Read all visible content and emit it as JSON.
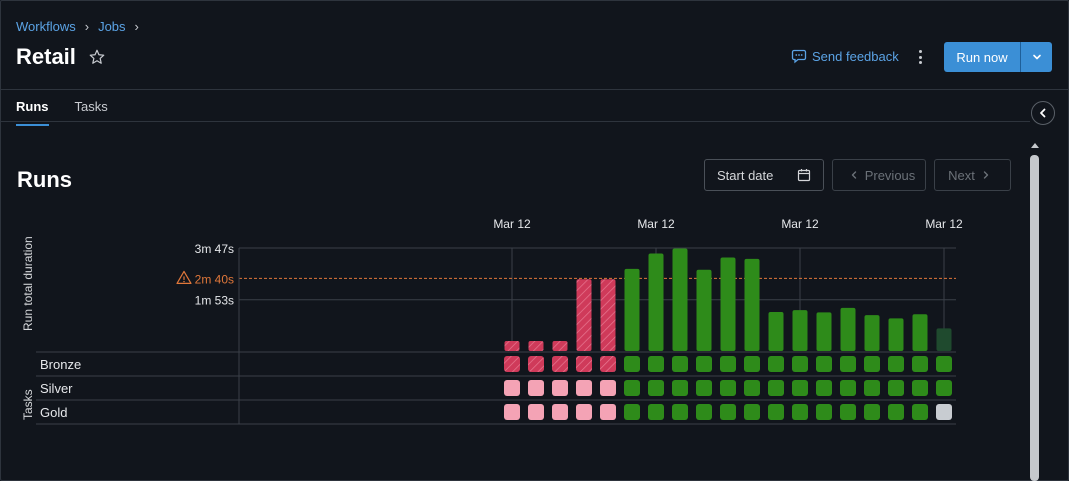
{
  "breadcrumb": {
    "items": [
      "Workflows",
      "Jobs"
    ],
    "separator": "›"
  },
  "header": {
    "title": "Retail",
    "feedback_label": "Send feedback",
    "run_now_label": "Run now"
  },
  "tabs": [
    {
      "label": "Runs",
      "active": true
    },
    {
      "label": "Tasks",
      "active": false
    }
  ],
  "runs": {
    "title": "Runs",
    "start_date_placeholder": "Start date",
    "previous_label": "Previous",
    "next_label": "Next"
  },
  "colors": {
    "accent": "#3b8fd6",
    "link": "#5ba3e5",
    "success": "#2e8b1a",
    "failed": "#d13b5c",
    "failed_light": "#f4a3b5",
    "pending": "#c8ccd1",
    "warning": "#e0773a"
  },
  "chart_data": {
    "type": "bar",
    "ylabel": "Run total duration",
    "task_axis_label": "Tasks",
    "x_tick_labels": [
      "Mar 12",
      "Mar 12",
      "Mar 12",
      "Mar 12"
    ],
    "y_tick_labels": [
      "3m 47s",
      "1m 53s"
    ],
    "ylim_seconds": [
      0,
      227
    ],
    "threshold": {
      "label": "2m 40s",
      "seconds": 160
    },
    "runs": [
      {
        "duration_s": 22,
        "status": "failed"
      },
      {
        "duration_s": 22,
        "status": "failed"
      },
      {
        "duration_s": 22,
        "status": "failed"
      },
      {
        "duration_s": 158,
        "status": "failed"
      },
      {
        "duration_s": 158,
        "status": "failed"
      },
      {
        "duration_s": 181,
        "status": "success"
      },
      {
        "duration_s": 215,
        "status": "success"
      },
      {
        "duration_s": 226,
        "status": "success"
      },
      {
        "duration_s": 179,
        "status": "success"
      },
      {
        "duration_s": 206,
        "status": "success"
      },
      {
        "duration_s": 203,
        "status": "success"
      },
      {
        "duration_s": 86,
        "status": "success"
      },
      {
        "duration_s": 90,
        "status": "success"
      },
      {
        "duration_s": 85,
        "status": "success"
      },
      {
        "duration_s": 95,
        "status": "success"
      },
      {
        "duration_s": 79,
        "status": "success"
      },
      {
        "duration_s": 72,
        "status": "success"
      },
      {
        "duration_s": 81,
        "status": "success"
      },
      {
        "duration_s": 50,
        "status": "running"
      }
    ],
    "tasks": [
      {
        "name": "Bronze",
        "statuses": [
          "failed",
          "failed",
          "failed",
          "failed",
          "failed",
          "success",
          "success",
          "success",
          "success",
          "success",
          "success",
          "success",
          "success",
          "success",
          "success",
          "success",
          "success",
          "success",
          "success"
        ]
      },
      {
        "name": "Silver",
        "statuses": [
          "upstream_failed",
          "upstream_failed",
          "upstream_failed",
          "upstream_failed",
          "upstream_failed",
          "success",
          "success",
          "success",
          "success",
          "success",
          "success",
          "success",
          "success",
          "success",
          "success",
          "success",
          "success",
          "success",
          "success"
        ]
      },
      {
        "name": "Gold",
        "statuses": [
          "upstream_failed",
          "upstream_failed",
          "upstream_failed",
          "upstream_failed",
          "upstream_failed",
          "success",
          "success",
          "success",
          "success",
          "success",
          "success",
          "success",
          "success",
          "success",
          "success",
          "success",
          "success",
          "success",
          "pending"
        ]
      }
    ]
  }
}
